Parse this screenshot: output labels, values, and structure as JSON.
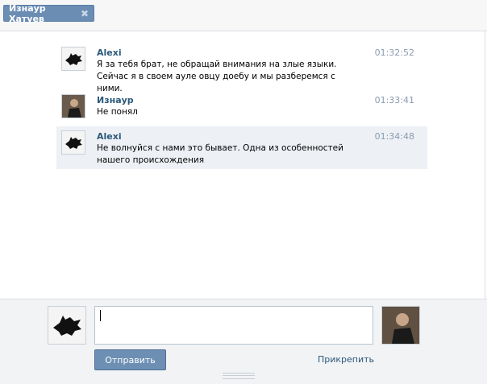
{
  "tab": {
    "title": "Изнаур Хатуев",
    "close_icon": "close-icon"
  },
  "messages": [
    {
      "author": "Alexi",
      "time": "01:32:52",
      "text": "Я за тебя брат, не обращай внимания на злые языки. Сейчас я в своем ауле овцу доебу и мы разберемся с ними.",
      "avatar": "wolf-avatar"
    },
    {
      "author": "Изнаур",
      "time": "01:33:41",
      "text": "Не понял",
      "avatar": "photo-avatar"
    },
    {
      "author": "Alexi",
      "time": "01:34:48",
      "text": "Не волнуйся с нами это бывает. Одна из особенностей нашего происхождения",
      "avatar": "wolf-avatar"
    }
  ],
  "compose": {
    "input_value": "",
    "send_label": "Отправить",
    "attach_label": "Прикрепить"
  },
  "colors": {
    "accent": "#6d8fb3",
    "author": "#2b587a",
    "time": "#8a9bb0",
    "highlight": "#edf1f5"
  }
}
